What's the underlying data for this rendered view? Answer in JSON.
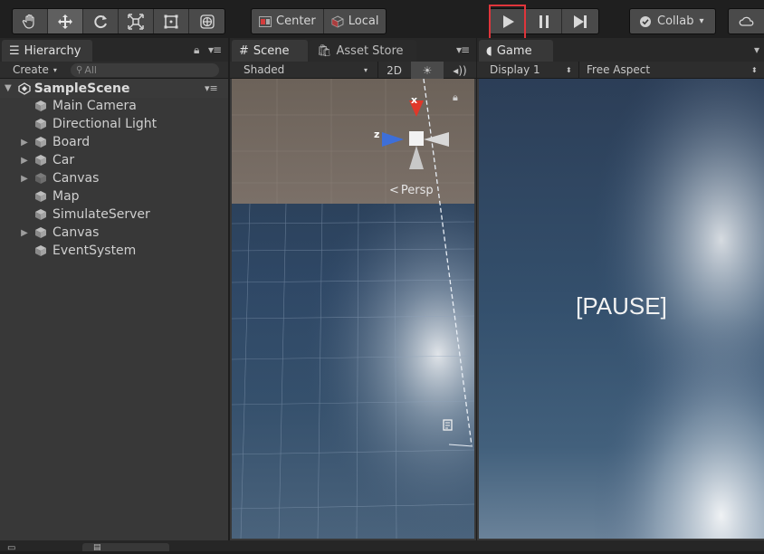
{
  "toolbar": {
    "pivot_label": "Center",
    "space_label": "Local",
    "collab_label": "Collab",
    "collab_caret": "▾",
    "tools": [
      "hand-icon",
      "move-icon",
      "rotate-icon",
      "scale-icon",
      "rect-icon",
      "transform-icon"
    ]
  },
  "hierarchy": {
    "tab_label": "Hierarchy",
    "create_label": "Create",
    "search_placeholder": "All",
    "scene_name": "SampleScene",
    "items": [
      {
        "label": "Main Camera",
        "expandable": false,
        "disabled": false
      },
      {
        "label": "Directional Light",
        "expandable": false,
        "disabled": false
      },
      {
        "label": "Board",
        "expandable": true,
        "disabled": false
      },
      {
        "label": "Car",
        "expandable": true,
        "disabled": false
      },
      {
        "label": "Canvas",
        "expandable": true,
        "disabled": true
      },
      {
        "label": "Map",
        "expandable": false,
        "disabled": false
      },
      {
        "label": "SimulateServer",
        "expandable": false,
        "disabled": false
      },
      {
        "label": "Canvas",
        "expandable": true,
        "disabled": false
      },
      {
        "label": "EventSystem",
        "expandable": false,
        "disabled": false
      }
    ]
  },
  "scene": {
    "tab_label": "Scene",
    "asset_store_label": "Asset Store",
    "shading_mode": "Shaded",
    "mode_2d": "2D",
    "persp_label": "Persp",
    "axis_x": "x",
    "axis_z": "z"
  },
  "game": {
    "tab_label": "Game",
    "display_label": "Display 1",
    "aspect_label": "Free Aspect",
    "pause_text": "[PAUSE]"
  },
  "colors": {
    "accent_highlight": "#e0353b",
    "panel_bg": "#383838",
    "toolbar_bg": "#1f1f1f",
    "axis_x": "#e0382a",
    "axis_z": "#3d6fd9"
  }
}
